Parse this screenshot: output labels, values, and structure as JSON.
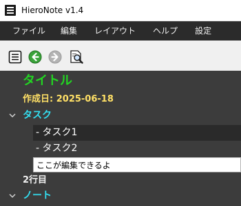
{
  "window": {
    "title": "HieroNote v1.4"
  },
  "menu": {
    "items": [
      "ファイル",
      "編集",
      "レイアウト",
      "ヘルプ",
      "設定"
    ]
  },
  "toolbar": {
    "buttons": [
      "outline-list-icon",
      "back-arrow-icon",
      "forward-arrow-icon",
      "document-search-icon"
    ]
  },
  "tree": {
    "title": "タイトル",
    "created": "作成日: 2025-06-18",
    "section1": "タスク",
    "tasks": [
      "- タスク1",
      "- タスク2"
    ],
    "edit_value": "ここが編集できるよ",
    "line2": "2行目",
    "section2": "ノート"
  },
  "colors": {
    "menubar_bg": "#2b2b2b",
    "tree_bg": "#3c3c3c",
    "title_green": "#22d622",
    "date_yellow": "#ffe066",
    "section_cyan": "#33e0f2"
  }
}
